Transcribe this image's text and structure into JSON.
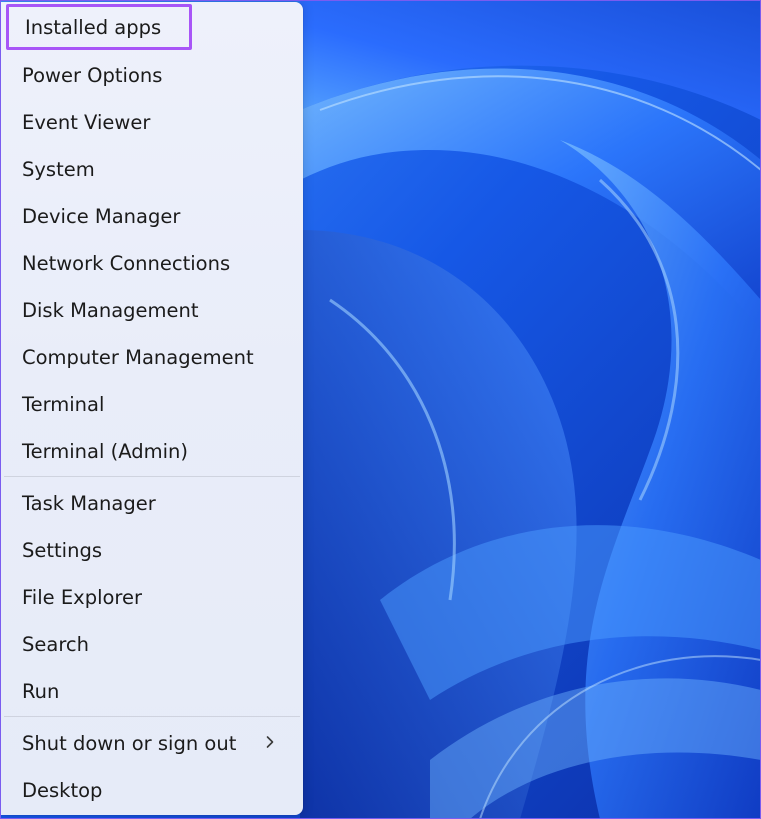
{
  "menu": {
    "items": [
      {
        "label": "Installed apps"
      },
      {
        "label": "Power Options"
      },
      {
        "label": "Event Viewer"
      },
      {
        "label": "System"
      },
      {
        "label": "Device Manager"
      },
      {
        "label": "Network Connections"
      },
      {
        "label": "Disk Management"
      },
      {
        "label": "Computer Management"
      },
      {
        "label": "Terminal"
      },
      {
        "label": "Terminal (Admin)"
      },
      {
        "label": "Task Manager"
      },
      {
        "label": "Settings"
      },
      {
        "label": "File Explorer"
      },
      {
        "label": "Search"
      },
      {
        "label": "Run"
      },
      {
        "label": "Shut down or sign out"
      },
      {
        "label": "Desktop"
      }
    ],
    "highlight_color": "#a855f7"
  },
  "wallpaper": {
    "theme": "Windows 11 Bloom",
    "base_color": "#1646c8"
  }
}
